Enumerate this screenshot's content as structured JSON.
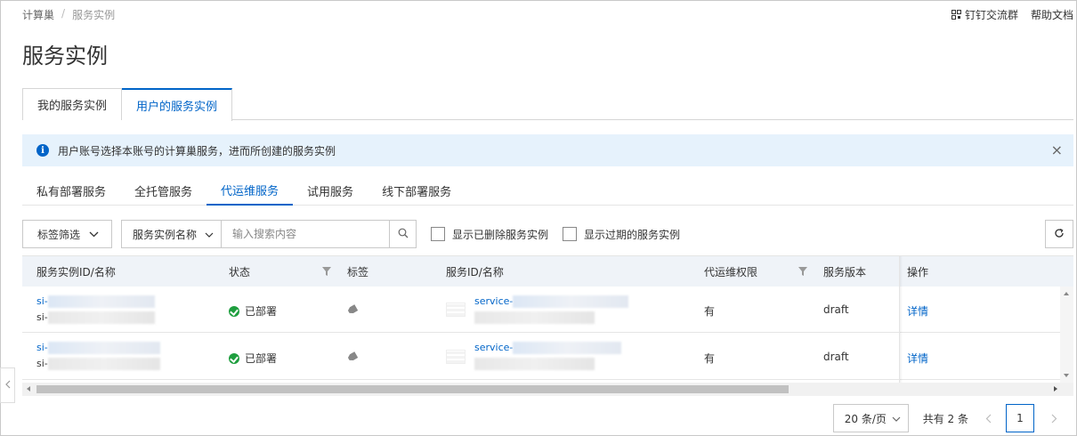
{
  "breadcrumb": {
    "root": "计算巢",
    "separator": "/",
    "current": "服务实例"
  },
  "header_links": {
    "dingtalk": "钉钉交流群",
    "help": "帮助文档"
  },
  "page_title": "服务实例",
  "tabs": [
    {
      "label": "我的服务实例"
    },
    {
      "label": "用户的服务实例",
      "active": true
    }
  ],
  "notice": {
    "text": "用户账号选择本账号的计算巢服务，进而所创建的服务实例",
    "close": "×"
  },
  "subtabs": [
    {
      "label": "私有部署服务"
    },
    {
      "label": "全托管服务"
    },
    {
      "label": "代运维服务",
      "active": true
    },
    {
      "label": "试用服务"
    },
    {
      "label": "线下部署服务"
    }
  ],
  "toolbar": {
    "tag_filter": "标签筛选",
    "search_field": "服务实例名称",
    "search_placeholder": "输入搜索内容",
    "show_deleted": "显示已删除服务实例",
    "show_expired": "显示过期的服务实例"
  },
  "table": {
    "headers": {
      "instance": "服务实例ID/名称",
      "status": "状态",
      "tags": "标签",
      "service": "服务ID/名称",
      "permission": "代运维权限",
      "version": "服务版本",
      "actions": "操作"
    },
    "rows": [
      {
        "id_prefix": "si-",
        "name_prefix": "si-",
        "status": "已部署",
        "service_prefix": "service-",
        "permission": "有",
        "version": "draft",
        "action": "详情"
      },
      {
        "id_prefix": "si-",
        "name_prefix": "si-",
        "status": "已部署",
        "service_prefix": "service-",
        "permission": "有",
        "version": "draft",
        "action": "详情"
      }
    ]
  },
  "pagination": {
    "page_size": "20 条/页",
    "total": "共有 2 条",
    "current_page": "1"
  },
  "colors": {
    "accent": "#0064c8",
    "success": "#1e9e3e",
    "notice_bg": "#e6f2fc",
    "header_bg": "#eff3f8"
  },
  "icons": [
    "qr-code-icon",
    "info-icon",
    "close-icon",
    "chevron-down-icon",
    "search-icon",
    "refresh-icon",
    "filter-icon",
    "check-circle-icon",
    "tag-icon",
    "chevron-left-icon",
    "chevron-right-icon"
  ]
}
